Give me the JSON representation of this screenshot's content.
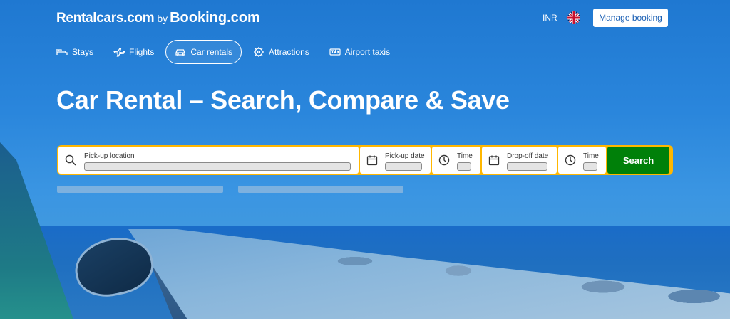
{
  "header": {
    "logo_rentalcars": "Rentalcars.com",
    "logo_by": "by",
    "logo_booking": "Booking.com",
    "currency": "INR",
    "flag_icon": "uk-flag-icon",
    "manage_booking": "Manage booking"
  },
  "nav": {
    "items": [
      {
        "label": "Stays",
        "icon": "bed-icon",
        "active": false
      },
      {
        "label": "Flights",
        "icon": "plane-icon",
        "active": false
      },
      {
        "label": "Car rentals",
        "icon": "car-icon",
        "active": true
      },
      {
        "label": "Attractions",
        "icon": "attractions-icon",
        "active": false
      },
      {
        "label": "Airport taxis",
        "icon": "taxi-icon",
        "active": false
      }
    ]
  },
  "hero": {
    "title": "Car Rental – Search, Compare & Save"
  },
  "search": {
    "pickup_location_label": "Pick-up location",
    "pickup_date_label": "Pick-up date",
    "pickup_time_label": "Time",
    "dropoff_date_label": "Drop-off date",
    "dropoff_time_label": "Time",
    "search_button": "Search"
  },
  "colors": {
    "accent_yellow": "#ffb700",
    "search_green": "#008009",
    "hero_blue": "#2a86dc"
  }
}
